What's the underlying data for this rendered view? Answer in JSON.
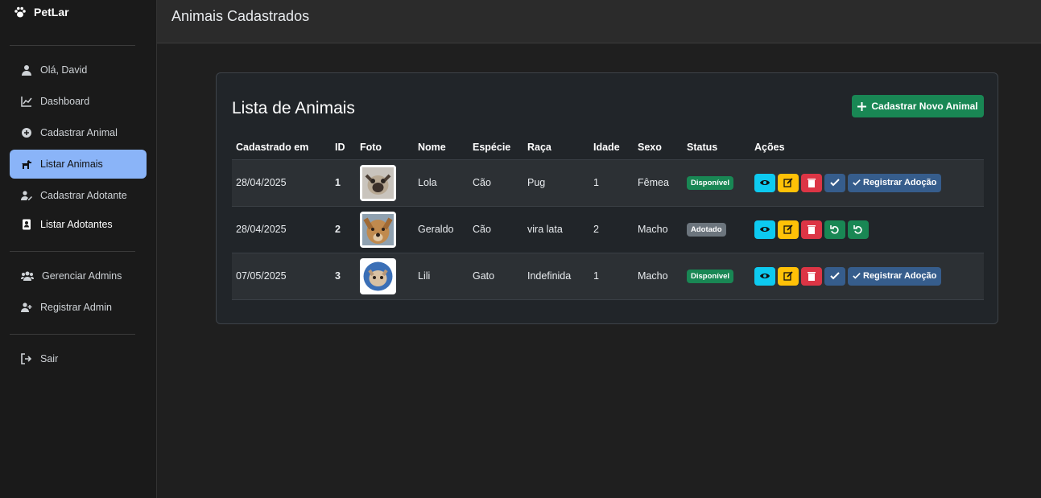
{
  "brand": {
    "name": "PetLar",
    "icon": "paw-icon"
  },
  "sidebar": {
    "items": [
      {
        "label": "Olá, David",
        "icon": "user-icon"
      },
      {
        "label": "Dashboard",
        "icon": "chart-line-icon"
      },
      {
        "label": "Cadastrar Animal",
        "icon": "plus-circle-icon"
      },
      {
        "label": "Listar Animais",
        "icon": "dog-icon",
        "active": true
      },
      {
        "label": "Cadastrar Adotante",
        "icon": "edit-user-icon"
      },
      {
        "label": "Listar Adotantes",
        "icon": "address-card-icon"
      },
      {
        "label": "Gerenciar Admins",
        "icon": "users-icon"
      },
      {
        "label": "Registrar Admin",
        "icon": "user-plus-icon"
      },
      {
        "label": "Sair",
        "icon": "sign-out-icon"
      }
    ]
  },
  "header": {
    "title": "Animais Cadastrados"
  },
  "card": {
    "title": "Lista de Animais",
    "new_button": "Cadastrar Novo Animal"
  },
  "table": {
    "columns": [
      "Cadastrado em",
      "ID",
      "Foto",
      "Nome",
      "Espécie",
      "Raça",
      "Idade",
      "Sexo",
      "Status",
      "Ações"
    ],
    "rows": [
      {
        "date": "28/04/2025",
        "id": "1",
        "name": "Lola",
        "species": "Cão",
        "breed": "Pug",
        "age": "1",
        "sex": "Fêmea",
        "status": "Disponível",
        "adopt_label": "Registrar Adoção"
      },
      {
        "date": "28/04/2025",
        "id": "2",
        "name": "Geraldo",
        "species": "Cão",
        "breed": "vira lata",
        "age": "2",
        "sex": "Macho",
        "status": "Adotado"
      },
      {
        "date": "07/05/2025",
        "id": "3",
        "name": "Lili",
        "species": "Gato",
        "breed": "Indefinida",
        "age": "1",
        "sex": "Macho",
        "status": "Disponível",
        "adopt_label": "Registrar Adoção"
      }
    ]
  },
  "colors": {
    "active_nav": "#8ab4f8",
    "success": "#198754",
    "info": "#0dcaf0",
    "warning": "#ffc107",
    "danger": "#dc3545",
    "secondary": "#6c757d"
  }
}
